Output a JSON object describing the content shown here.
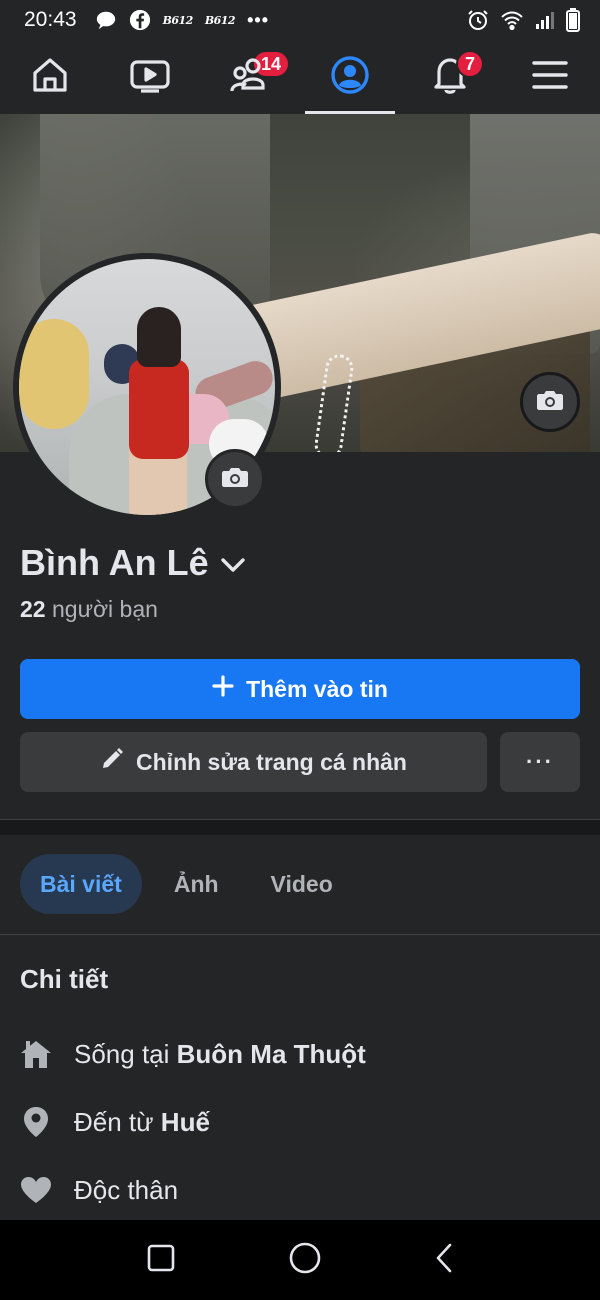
{
  "status_bar": {
    "time": "20:43",
    "left_icons": [
      "message-bubble-icon",
      "facebook-icon",
      "b612-icon",
      "b612-icon",
      "more-dots-icon"
    ],
    "b612_label": "B612",
    "right_icons": [
      "alarm-icon",
      "wifi-icon",
      "signal-icon",
      "battery-icon"
    ]
  },
  "nav": {
    "items": [
      {
        "name": "home",
        "icon": "home-icon"
      },
      {
        "name": "watch",
        "icon": "video-icon",
        "badge": "14"
      },
      {
        "name": "friends",
        "icon": "friends-icon"
      },
      {
        "name": "profile",
        "icon": "profile-icon",
        "active": true
      },
      {
        "name": "notifications",
        "icon": "bell-icon",
        "badge": "7"
      },
      {
        "name": "menu",
        "icon": "menu-icon"
      }
    ]
  },
  "profile": {
    "name": "Bình An Lê",
    "friends_count": "22",
    "friends_label": "người bạn"
  },
  "actions": {
    "add_story": "Thêm vào tin",
    "edit_profile": "Chỉnh sửa trang cá nhân",
    "more": "···"
  },
  "tabs": [
    {
      "label": "Bài viết",
      "active": true
    },
    {
      "label": "Ảnh"
    },
    {
      "label": "Video"
    }
  ],
  "details": {
    "title": "Chi tiết",
    "lives_in_prefix": "Sống tại",
    "lives_in": "Buôn Ma Thuột",
    "from_prefix": "Đến từ",
    "from": "Huế",
    "relationship": "Độc thân"
  },
  "colors": {
    "accent": "#1877f2",
    "badge": "#e41e3f",
    "active_tab_text": "#5aa7ff",
    "surface": "#242526",
    "button": "#3a3b3c"
  }
}
